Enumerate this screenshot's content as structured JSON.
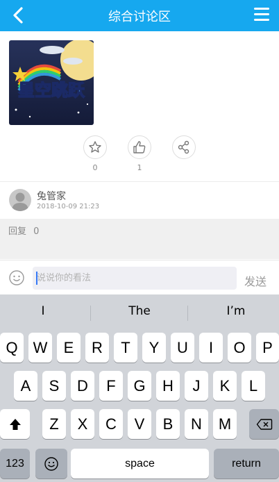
{
  "header": {
    "title": "综合讨论区",
    "back_icon": "chevron-left-icon",
    "menu_icon": "hamburger-menu-icon",
    "color": "#16a8ef"
  },
  "post": {
    "game_image_icon": "starry-jump-game-icon",
    "game_image_text": "星空跳跃",
    "actions": [
      {
        "icon": "star-icon",
        "count": "0"
      },
      {
        "icon": "thumbs-up-icon",
        "count": "1"
      },
      {
        "icon": "share-icon",
        "count": ""
      }
    ]
  },
  "comment": {
    "name": "兔管家",
    "time": "2018-10-09  21:23",
    "reply_label": "回复",
    "reply_count": "0"
  },
  "input_bar": {
    "placeholder": "说说你的看法",
    "send_label": "发送",
    "emoji_icon": "smiley-icon"
  },
  "keyboard": {
    "suggestions": [
      "I",
      "The",
      "I’m"
    ],
    "row1": [
      "Q",
      "W",
      "E",
      "R",
      "T",
      "Y",
      "U",
      "I",
      "O",
      "P"
    ],
    "row2": [
      "A",
      "S",
      "D",
      "F",
      "G",
      "H",
      "J",
      "K",
      "L"
    ],
    "row3": [
      "Z",
      "X",
      "C",
      "V",
      "B",
      "N",
      "M"
    ],
    "numbers_label": "123",
    "space_label": "space",
    "return_label": "return"
  }
}
